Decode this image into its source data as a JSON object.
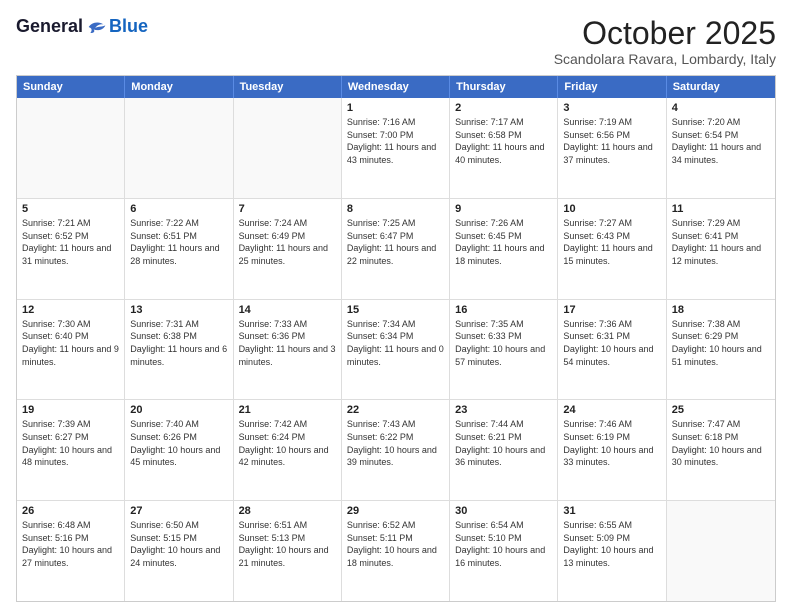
{
  "logo": {
    "general": "General",
    "blue": "Blue"
  },
  "title": {
    "month": "October 2025",
    "location": "Scandolara Ravara, Lombardy, Italy"
  },
  "header_days": [
    "Sunday",
    "Monday",
    "Tuesday",
    "Wednesday",
    "Thursday",
    "Friday",
    "Saturday"
  ],
  "rows": [
    [
      {
        "day": "",
        "info": ""
      },
      {
        "day": "",
        "info": ""
      },
      {
        "day": "",
        "info": ""
      },
      {
        "day": "1",
        "info": "Sunrise: 7:16 AM\nSunset: 7:00 PM\nDaylight: 11 hours and 43 minutes."
      },
      {
        "day": "2",
        "info": "Sunrise: 7:17 AM\nSunset: 6:58 PM\nDaylight: 11 hours and 40 minutes."
      },
      {
        "day": "3",
        "info": "Sunrise: 7:19 AM\nSunset: 6:56 PM\nDaylight: 11 hours and 37 minutes."
      },
      {
        "day": "4",
        "info": "Sunrise: 7:20 AM\nSunset: 6:54 PM\nDaylight: 11 hours and 34 minutes."
      }
    ],
    [
      {
        "day": "5",
        "info": "Sunrise: 7:21 AM\nSunset: 6:52 PM\nDaylight: 11 hours and 31 minutes."
      },
      {
        "day": "6",
        "info": "Sunrise: 7:22 AM\nSunset: 6:51 PM\nDaylight: 11 hours and 28 minutes."
      },
      {
        "day": "7",
        "info": "Sunrise: 7:24 AM\nSunset: 6:49 PM\nDaylight: 11 hours and 25 minutes."
      },
      {
        "day": "8",
        "info": "Sunrise: 7:25 AM\nSunset: 6:47 PM\nDaylight: 11 hours and 22 minutes."
      },
      {
        "day": "9",
        "info": "Sunrise: 7:26 AM\nSunset: 6:45 PM\nDaylight: 11 hours and 18 minutes."
      },
      {
        "day": "10",
        "info": "Sunrise: 7:27 AM\nSunset: 6:43 PM\nDaylight: 11 hours and 15 minutes."
      },
      {
        "day": "11",
        "info": "Sunrise: 7:29 AM\nSunset: 6:41 PM\nDaylight: 11 hours and 12 minutes."
      }
    ],
    [
      {
        "day": "12",
        "info": "Sunrise: 7:30 AM\nSunset: 6:40 PM\nDaylight: 11 hours and 9 minutes."
      },
      {
        "day": "13",
        "info": "Sunrise: 7:31 AM\nSunset: 6:38 PM\nDaylight: 11 hours and 6 minutes."
      },
      {
        "day": "14",
        "info": "Sunrise: 7:33 AM\nSunset: 6:36 PM\nDaylight: 11 hours and 3 minutes."
      },
      {
        "day": "15",
        "info": "Sunrise: 7:34 AM\nSunset: 6:34 PM\nDaylight: 11 hours and 0 minutes."
      },
      {
        "day": "16",
        "info": "Sunrise: 7:35 AM\nSunset: 6:33 PM\nDaylight: 10 hours and 57 minutes."
      },
      {
        "day": "17",
        "info": "Sunrise: 7:36 AM\nSunset: 6:31 PM\nDaylight: 10 hours and 54 minutes."
      },
      {
        "day": "18",
        "info": "Sunrise: 7:38 AM\nSunset: 6:29 PM\nDaylight: 10 hours and 51 minutes."
      }
    ],
    [
      {
        "day": "19",
        "info": "Sunrise: 7:39 AM\nSunset: 6:27 PM\nDaylight: 10 hours and 48 minutes."
      },
      {
        "day": "20",
        "info": "Sunrise: 7:40 AM\nSunset: 6:26 PM\nDaylight: 10 hours and 45 minutes."
      },
      {
        "day": "21",
        "info": "Sunrise: 7:42 AM\nSunset: 6:24 PM\nDaylight: 10 hours and 42 minutes."
      },
      {
        "day": "22",
        "info": "Sunrise: 7:43 AM\nSunset: 6:22 PM\nDaylight: 10 hours and 39 minutes."
      },
      {
        "day": "23",
        "info": "Sunrise: 7:44 AM\nSunset: 6:21 PM\nDaylight: 10 hours and 36 minutes."
      },
      {
        "day": "24",
        "info": "Sunrise: 7:46 AM\nSunset: 6:19 PM\nDaylight: 10 hours and 33 minutes."
      },
      {
        "day": "25",
        "info": "Sunrise: 7:47 AM\nSunset: 6:18 PM\nDaylight: 10 hours and 30 minutes."
      }
    ],
    [
      {
        "day": "26",
        "info": "Sunrise: 6:48 AM\nSunset: 5:16 PM\nDaylight: 10 hours and 27 minutes."
      },
      {
        "day": "27",
        "info": "Sunrise: 6:50 AM\nSunset: 5:15 PM\nDaylight: 10 hours and 24 minutes."
      },
      {
        "day": "28",
        "info": "Sunrise: 6:51 AM\nSunset: 5:13 PM\nDaylight: 10 hours and 21 minutes."
      },
      {
        "day": "29",
        "info": "Sunrise: 6:52 AM\nSunset: 5:11 PM\nDaylight: 10 hours and 18 minutes."
      },
      {
        "day": "30",
        "info": "Sunrise: 6:54 AM\nSunset: 5:10 PM\nDaylight: 10 hours and 16 minutes."
      },
      {
        "day": "31",
        "info": "Sunrise: 6:55 AM\nSunset: 5:09 PM\nDaylight: 10 hours and 13 minutes."
      },
      {
        "day": "",
        "info": ""
      }
    ]
  ]
}
